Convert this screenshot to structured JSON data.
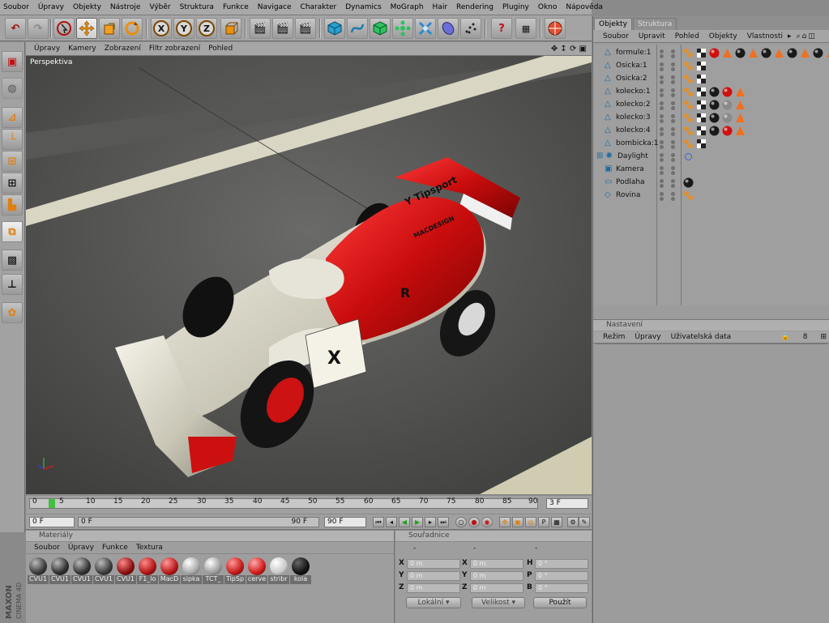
{
  "menubar": [
    "Soubor",
    "Úpravy",
    "Objekty",
    "Nástroje",
    "Výběr",
    "Struktura",
    "Funkce",
    "Navigace",
    "Charakter",
    "Dynamics",
    "MoGraph",
    "Hair",
    "Rendering",
    "Pluginy",
    "Okno",
    "Nápověda"
  ],
  "toolbar": {
    "undo": "undo-icon",
    "redo": "redo-icon",
    "select": "live-selection-icon",
    "move": "move-icon",
    "scale": "scale-icon",
    "rotate": "rotate-icon",
    "x_axis": "X",
    "y_axis": "Y",
    "z_axis": "Z"
  },
  "viewport": {
    "menu": [
      "Úpravy",
      "Kamery",
      "Zobrazení",
      "Filtr zobrazení",
      "Pohled"
    ],
    "label": "Perspektiva"
  },
  "timeline": {
    "ticks": [
      "0",
      "5",
      "10",
      "15",
      "20",
      "25",
      "30",
      "35",
      "40",
      "45",
      "50",
      "55",
      "60",
      "65",
      "70",
      "75",
      "80",
      "85",
      "90"
    ],
    "current_frame": "3 F",
    "start_field": "0 F",
    "range_start": "0 F",
    "range_end": "90 F",
    "end_field": "90 F"
  },
  "materials": {
    "title": "Materiály",
    "menu": [
      "Soubor",
      "Úpravy",
      "Funkce",
      "Textura"
    ],
    "items": [
      {
        "name": "CVU1",
        "color": "#3a3a3a"
      },
      {
        "name": "CVU1",
        "color": "#2e2e2e"
      },
      {
        "name": "CVU1",
        "color": "#333333"
      },
      {
        "name": "CVU1",
        "color": "#3c3c3c"
      },
      {
        "name": "CVU1",
        "color": "#8a1010"
      },
      {
        "name": "F1_lo",
        "color": "#b01515"
      },
      {
        "name": "MacD",
        "color": "#b81818"
      },
      {
        "name": "sipka",
        "color": "#a8a8a8"
      },
      {
        "name": "TCT_",
        "color": "#9c9c9c"
      },
      {
        "name": "TipSp",
        "color": "#c41a1a"
      },
      {
        "name": "cerve",
        "color": "#d01c1c"
      },
      {
        "name": "stribr",
        "color": "#c8c8c8"
      },
      {
        "name": "kola",
        "color": "#121212"
      }
    ]
  },
  "coordinates": {
    "title": "Souřadnice",
    "col_headers": [
      "-",
      "-",
      "-"
    ],
    "rows": [
      {
        "a": "X",
        "av": "0 m",
        "b": "X",
        "bv": "0 m",
        "c": "H",
        "cv": "0 °"
      },
      {
        "a": "Y",
        "av": "0 m",
        "b": "Y",
        "bv": "0 m",
        "c": "P",
        "cv": "0 °"
      },
      {
        "a": "Z",
        "av": "0 m",
        "b": "Z",
        "bv": "0 m",
        "c": "B",
        "cv": "0 °"
      }
    ],
    "mode1": "Lokální",
    "mode2": "Velikost",
    "apply": "Použít"
  },
  "objects": {
    "tabs": [
      "Objekty",
      "Struktura"
    ],
    "menu": [
      "Soubor",
      "Upravit",
      "Pohled",
      "Objekty",
      "Vlastnosti"
    ],
    "rows": [
      {
        "name": "formule:1"
      },
      {
        "name": "Osicka:1"
      },
      {
        "name": "Osicka:2"
      },
      {
        "name": "kolecko:1"
      },
      {
        "name": "kolecko:2"
      },
      {
        "name": "kolecko:3"
      },
      {
        "name": "kolecko:4"
      },
      {
        "name": "bombicka:1"
      },
      {
        "name": "Daylight"
      },
      {
        "name": "Kamera"
      },
      {
        "name": "Podlaha"
      },
      {
        "name": "Rovina"
      }
    ]
  },
  "attributes": {
    "title": "Nastavení",
    "menu": [
      "Režim",
      "Úpravy",
      "Uživatelská data"
    ]
  },
  "brand": {
    "line1": "MAXON",
    "line2": "CINEMA 4D"
  }
}
